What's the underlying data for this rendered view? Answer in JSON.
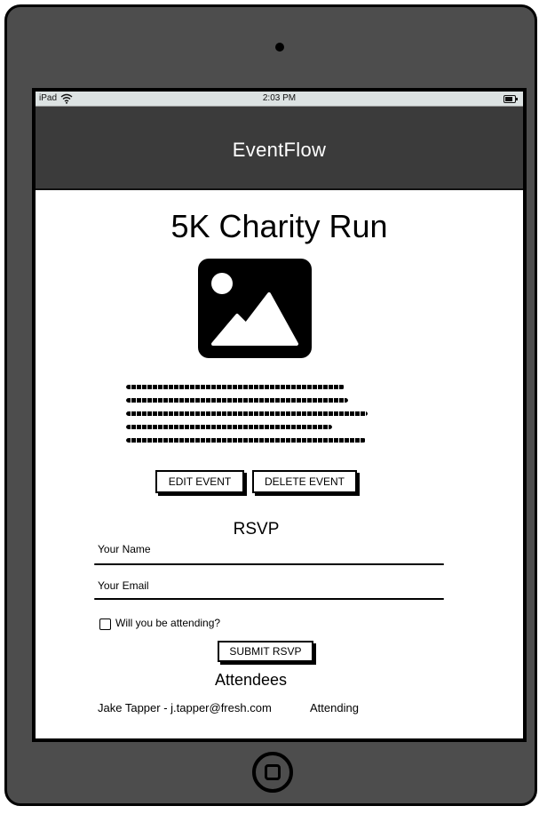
{
  "status_bar": {
    "device": "iPad",
    "time": "2:03 PM",
    "wifi_icon": "wifi-icon",
    "battery_icon": "battery-icon"
  },
  "app": {
    "title": "EventFlow"
  },
  "event": {
    "title": "5K Charity Run",
    "image_icon": "image-placeholder-icon",
    "description_lines": 5
  },
  "actions": {
    "edit_label": "EDIT EVENT",
    "delete_label": "DELETE EVENT"
  },
  "rsvp": {
    "heading": "RSVP",
    "name_label": "Your Name",
    "email_label": "Your Email",
    "attending_label": "Will you be attending?",
    "attending_checked": false,
    "submit_label": "SUBMIT RSVP"
  },
  "attendees": {
    "heading": "Attendees",
    "rows": [
      {
        "name": "Jake Tapper - j.tapper@fresh.com",
        "status": "Attending"
      }
    ]
  },
  "colors": {
    "device_body": "#4d4d4d",
    "app_bar": "#3b3b3b",
    "status_bar": "#dde3e3"
  }
}
